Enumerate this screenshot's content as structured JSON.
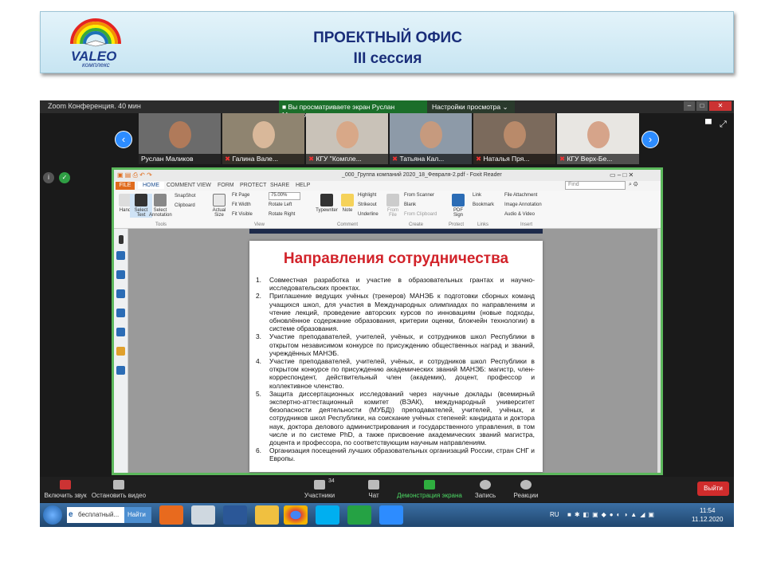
{
  "slide": {
    "title_line1": "ПРОЕКТНЫЙ ОФИС",
    "title_line2": "III сессия",
    "logo_text": "VALEO",
    "logo_sub": "комплекс"
  },
  "zoom": {
    "window_title": "Zoom Конференция. 40 мин",
    "banner": "Вы просматриваете экран Руслан Маликов",
    "view_options": "Настройки просмотра ⌄",
    "participants": [
      {
        "name": "Руслан Маликов",
        "muted": false
      },
      {
        "name": "Галина Вале...",
        "muted": true
      },
      {
        "name": "КГУ \"Компле...",
        "muted": true
      },
      {
        "name": "Татьяна Кал...",
        "muted": true
      },
      {
        "name": "Наталья Пря...",
        "muted": true
      },
      {
        "name": "КГУ Верх-Бе...",
        "muted": true
      }
    ],
    "controls": {
      "mute": "Включить звук",
      "video": "Остановить видео",
      "participants": "Участники",
      "participants_count": "34",
      "chat": "Чат",
      "share": "Демонстрация экрана",
      "record": "Запись",
      "reactions": "Реакции",
      "leave": "Выйти"
    }
  },
  "reader": {
    "title": "_000_Группа компаний 2020_18_Февраля-2.pdf - Foxit Reader",
    "file_tab": "FILE",
    "tabs": [
      "HOME",
      "COMMENT",
      "VIEW",
      "FORM",
      "PROTECT",
      "SHARE",
      "HELP"
    ],
    "search_placeholder": "Find",
    "ribbon": {
      "hand": "Hand",
      "select_text": "Select Text",
      "select_annotation": "Select Annotation",
      "snapshot": "SnapShot",
      "clipboard": "Clipboard",
      "tools": "Tools",
      "actual_size": "Actual Size",
      "fit_page": "Fit Page",
      "fit_width": "Fit Width",
      "fit_visible": "Fit Visible",
      "zoom": "75.00%",
      "rotate_left": "Rotate Left",
      "rotate_right": "Rotate Right",
      "view": "View",
      "typewriter": "Typewriter",
      "note": "Note",
      "highlight": "Highlight",
      "strikeout": "Strikeout",
      "underline": "Underline",
      "comment": "Comment",
      "from_file": "From File",
      "from_scanner": "From Scanner",
      "blank": "Blank",
      "from_clipboard": "From Clipboard",
      "create": "Create",
      "pdf_sign": "PDF Sign",
      "protect": "Protect",
      "link": "Link",
      "bookmark": "Bookmark",
      "links": "Links",
      "file_attachment": "File Attachment",
      "image_annotation": "Image Annotation",
      "audio_video": "Audio & Video",
      "insert": "Insert"
    },
    "page_title": "Направления сотрудничества",
    "items": [
      {
        "n": "1.",
        "text": "Совместная разработка и участие в образовательных грантах и научно-исследовательских проектах."
      },
      {
        "n": "2.",
        "text": "Приглашение ведущих учёных (тренеров) МАНЭБ к подготовки сборных команд учащихся школ, для участия в Международных олимпиадах по направлениям и чтение лекций, проведение авторских курсов по инновациям (новые подходы, обновлённое содержание образования, критерии оценки, блокчейн технологии) в системе образования."
      },
      {
        "n": "3.",
        "text": "Участие преподавателей, учителей, учёных, и сотрудников школ Республики в открытом независимом конкурсе по присуждению общественных наград и званий, учреждённых МАНЭБ."
      },
      {
        "n": "4.",
        "text": "Участие преподавателей, учителей, учёных, и сотрудников школ Республики в открытом конкурсе по присуждению академических званий МАНЭБ: магистр, член-корреспондент, действительный член (академик), доцент, профессор и коллективное членство."
      },
      {
        "n": "5.",
        "text": "Защита диссертационных исследований через научные доклады (всемирный экспертно-аттестационный комитет (ВЭАК), международный университет безопасности деятельности (МУБД)) преподавателей, учителей, учёных, и сотрудников школ Республики, на соискание учёных степеней: кандидата и доктора наук, доктора делового администрирования и государственного управления, в том числе и по системе PhD, а также присвоение академических званий магистра, доцента и профессора, по соответствующим научным направлениям."
      },
      {
        "n": "6.",
        "text": "Организация посещений лучших образовательных организаций России, стран СНГ и Европы."
      }
    ]
  },
  "taskbar": {
    "search": "бесплатный...",
    "find": "Найти",
    "lang": "RU",
    "time": "11:54",
    "date": "11.12.2020"
  }
}
